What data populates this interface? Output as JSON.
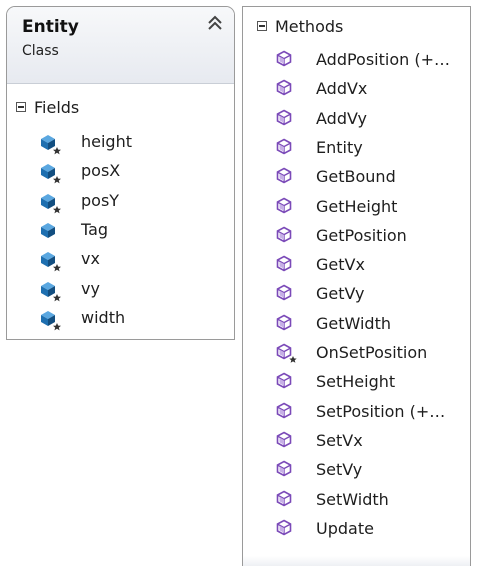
{
  "class_box": {
    "name": "Entity",
    "stereotype": "Class",
    "collapse_icon": "double-chevron-up-icon"
  },
  "fields": {
    "title": "Fields",
    "items": [
      {
        "label": "height",
        "icon": "protected-field-icon"
      },
      {
        "label": "posX",
        "icon": "protected-field-icon"
      },
      {
        "label": "posY",
        "icon": "protected-field-icon"
      },
      {
        "label": "Tag",
        "icon": "public-field-icon"
      },
      {
        "label": "vx",
        "icon": "protected-field-icon"
      },
      {
        "label": "vy",
        "icon": "protected-field-icon"
      },
      {
        "label": "width",
        "icon": "protected-field-icon"
      }
    ]
  },
  "methods": {
    "title": "Methods",
    "items": [
      {
        "label": "AddPosition (+…",
        "icon": "public-method-icon"
      },
      {
        "label": "AddVx",
        "icon": "public-method-icon"
      },
      {
        "label": "AddVy",
        "icon": "public-method-icon"
      },
      {
        "label": "Entity",
        "icon": "public-method-icon"
      },
      {
        "label": "GetBound",
        "icon": "public-method-icon"
      },
      {
        "label": "GetHeight",
        "icon": "public-method-icon"
      },
      {
        "label": "GetPosition",
        "icon": "public-method-icon"
      },
      {
        "label": "GetVx",
        "icon": "public-method-icon"
      },
      {
        "label": "GetVy",
        "icon": "public-method-icon"
      },
      {
        "label": "GetWidth",
        "icon": "public-method-icon"
      },
      {
        "label": "OnSetPosition",
        "icon": "protected-method-icon"
      },
      {
        "label": "SetHeight",
        "icon": "public-method-icon"
      },
      {
        "label": "SetPosition (+…",
        "icon": "public-method-icon"
      },
      {
        "label": "SetVx",
        "icon": "public-method-icon"
      },
      {
        "label": "SetVy",
        "icon": "public-method-icon"
      },
      {
        "label": "SetWidth",
        "icon": "public-method-icon"
      },
      {
        "label": "Update",
        "icon": "public-method-icon"
      }
    ]
  },
  "colors": {
    "field_icon": "#1e6fb0",
    "method_icon": "#7b4ab8",
    "border": "#9a9a9a"
  }
}
